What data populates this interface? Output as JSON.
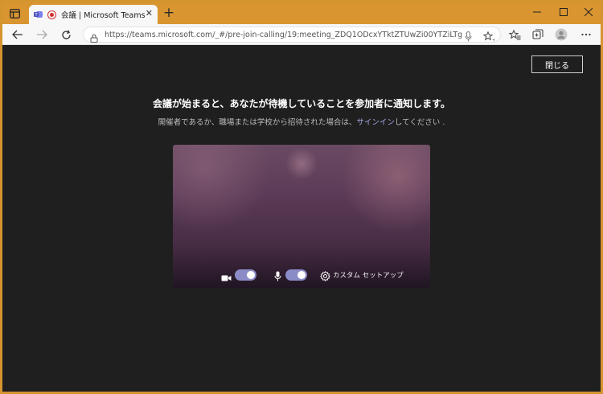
{
  "browser": {
    "tab_title": "会議 | Microsoft Teams",
    "tab_close": "✕",
    "new_tab": "+",
    "url": "https://teams.microsoft.com/_#/pre-join-calling/19:meeting_ZDQ1ODcxYTktZTUwZi00YTZiLTgzMzYtN2...",
    "colors": {
      "frame": "#d99530",
      "tab_bg": "#f7f7f7"
    }
  },
  "meeting": {
    "close_button": "閉じる",
    "heading": "会議が始まると、あなたが待機していることを参加者に通知します。",
    "subtext_prefix": "開催者であるか、職場または学校から招待された場合は、",
    "signin_link": "サインイン",
    "subtext_suffix": "してください .",
    "camera_on": true,
    "mic_on": true,
    "custom_setup": "カスタム セットアップ",
    "colors": {
      "background": "#1f1f1f",
      "toggle": "#8b8cc7",
      "link": "#a6a7e3"
    }
  }
}
